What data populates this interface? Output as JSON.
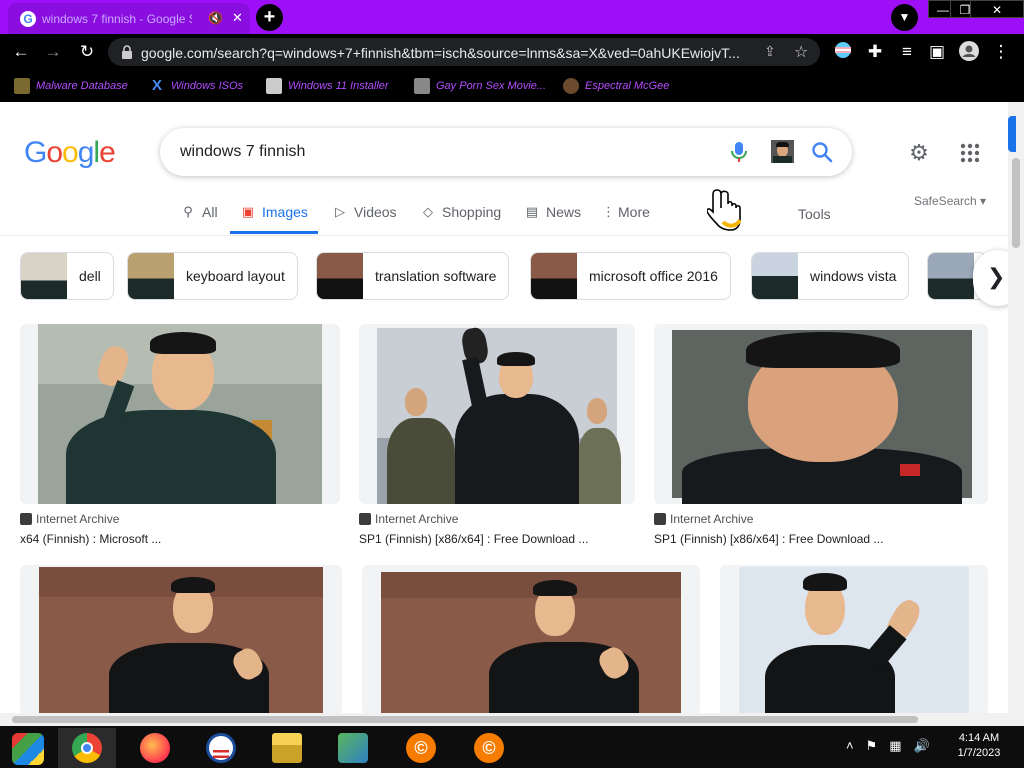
{
  "window": {
    "tab_title": "windows 7 finnish - Google S...",
    "tab_mute_icon": "speaker-mute-icon",
    "controls": {
      "minimize": "—",
      "restore": "❐",
      "close": "✕"
    }
  },
  "toolbar": {
    "url": "google.com/search?q=windows+7+finnish&tbm=isch&source=lnms&sa=X&ved=0ahUKEwiojvT..."
  },
  "bookmarks": [
    {
      "label": "Malware Database",
      "icon_color": "#7a6a2f"
    },
    {
      "label": "Windows ISOs",
      "icon_color": "#1e1e1e"
    },
    {
      "label": "Windows 11 Installer",
      "icon_color": "#cccccc"
    },
    {
      "label": "Gay Porn Sex Movie...",
      "icon_color": "#999999"
    },
    {
      "label": "Espectral McGee",
      "icon_color": "#6b4a2e"
    }
  ],
  "search": {
    "logo": "Google",
    "query": "windows 7 finnish"
  },
  "nav": {
    "tabs": [
      {
        "label": "All",
        "icon": "search-icon"
      },
      {
        "label": "Images",
        "icon": "image-icon",
        "active": true
      },
      {
        "label": "Videos",
        "icon": "play-icon"
      },
      {
        "label": "Shopping",
        "icon": "tag-icon"
      },
      {
        "label": "News",
        "icon": "newspaper-icon"
      },
      {
        "label": "More",
        "icon": "kebab-icon"
      }
    ],
    "tools": "Tools",
    "safesearch": "SafeSearch"
  },
  "chips": [
    {
      "label": "dell"
    },
    {
      "label": "keyboard layout"
    },
    {
      "label": "translation software"
    },
    {
      "label": "microsoft office 2016"
    },
    {
      "label": "windows vista"
    }
  ],
  "results": [
    {
      "source": "Internet Archive",
      "title": "x64 (Finnish) : Microsoft ..."
    },
    {
      "source": "Internet Archive",
      "title": "SP1 (Finnish) [x86/x64] : Free Download ..."
    },
    {
      "source": "Internet Archive",
      "title": "SP1 (Finnish) [x86/x64] : Free Download ..."
    },
    {
      "source": "",
      "title": ""
    },
    {
      "source": "",
      "title": ""
    },
    {
      "source": "",
      "title": ""
    }
  ],
  "taskbar": {
    "apps": [
      {
        "name": "windows-start-icon"
      },
      {
        "name": "chrome-icon",
        "active": true
      },
      {
        "name": "firefox-icon"
      },
      {
        "name": "obama-logo-icon"
      },
      {
        "name": "file-explorer-icon"
      },
      {
        "name": "network-people-icon"
      },
      {
        "name": "c-coin-icon"
      },
      {
        "name": "c-coin-icon"
      }
    ],
    "time": "4:14 AM",
    "date": "1/7/2023"
  },
  "colors": {
    "tabstrip": "#9d10f7",
    "bookmark_text": "#b44dff",
    "google_blue": "#4285f4",
    "google_red": "#ea4335",
    "google_yellow": "#fbbc05",
    "google_green": "#34a853",
    "active_tab_blue": "#1a73e8"
  }
}
